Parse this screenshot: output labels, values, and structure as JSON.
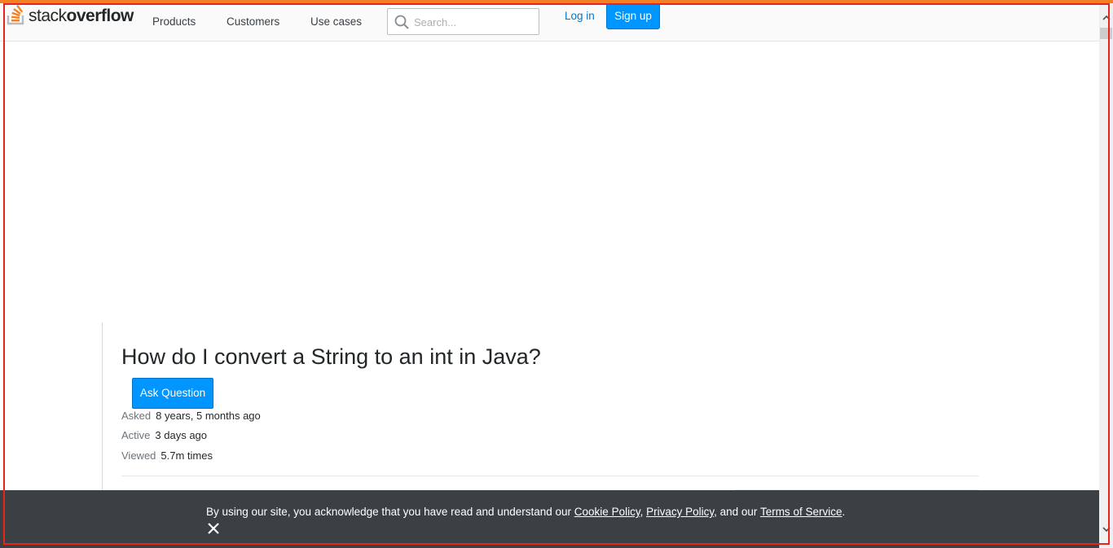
{
  "header": {
    "logo_text_light": "stack",
    "logo_text_bold": "overflow",
    "nav": [
      {
        "label": "Products"
      },
      {
        "label": "Customers"
      },
      {
        "label": "Use cases"
      }
    ],
    "search": {
      "placeholder": "Search...",
      "value": ""
    },
    "login_label": "Log in",
    "signup_label": "Sign up"
  },
  "question": {
    "title": "How do I convert a String to an int in Java?",
    "ask_button_label": "Ask Question",
    "meta": {
      "asked_label": "Asked",
      "asked_value": "8 years, 5 months ago",
      "active_label": "Active",
      "active_value": "3 days ago",
      "viewed_label": "Viewed",
      "viewed_value": "5.7m times"
    }
  },
  "cookie_banner": {
    "text_before": "By using our site, you acknowledge that you have read and understand our ",
    "cookie_policy": "Cookie Policy",
    "sep1": ", ",
    "privacy_policy": "Privacy Policy",
    "sep2": ", and our ",
    "terms": "Terms of Service",
    "end": "."
  },
  "colors": {
    "accent_orange": "#f48024",
    "primary_blue": "#0095ff",
    "link_blue": "#0077cc",
    "banner_bg": "#3b4045",
    "focus_outline": "#e8241c"
  },
  "icons": {
    "logo": "stackoverflow-logo-icon",
    "search": "search-icon",
    "close": "close-icon",
    "scroll_up": "chevron-up-icon",
    "scroll_down": "chevron-down-icon"
  }
}
